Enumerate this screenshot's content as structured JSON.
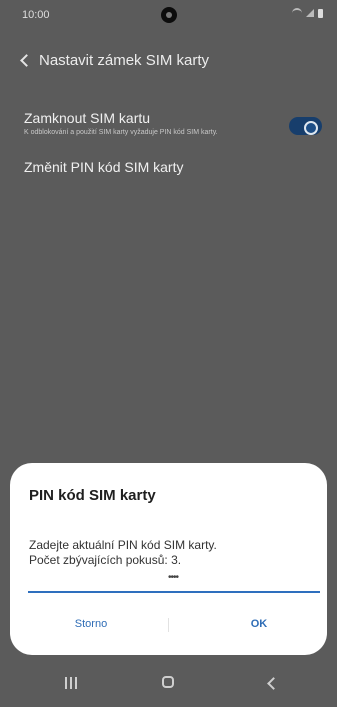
{
  "status_bar": {
    "time": "10:00",
    "icons": [
      "notification-icon",
      "wifi-icon",
      "signal-icon",
      "battery-icon"
    ]
  },
  "header": {
    "title": "Nastavit zámek SIM karty",
    "back_icon": "back-arrow-icon"
  },
  "settings": {
    "lock_sim": {
      "title": "Zamknout SIM kartu",
      "subtitle": "K odblokování a použití SIM karty vyžaduje PIN kód SIM karty.",
      "enabled": true
    },
    "change_pin": {
      "title": "Změnit PIN kód SIM karty"
    }
  },
  "dialog": {
    "title": "PIN kód SIM karty",
    "message_line1": "Zadejte aktuální PIN kód SIM karty.",
    "message_line2": "Počet zbývajících pokusů: 3.",
    "pin_value": "••••",
    "cancel_label": "Storno",
    "ok_label": "OK"
  },
  "nav_bar": {
    "icons": [
      "recent-apps-icon",
      "home-icon",
      "back-icon"
    ]
  },
  "colors": {
    "background_dimmed": "#5b5b5b",
    "dialog_background": "#ffffff",
    "accent": "#2f6db6"
  }
}
